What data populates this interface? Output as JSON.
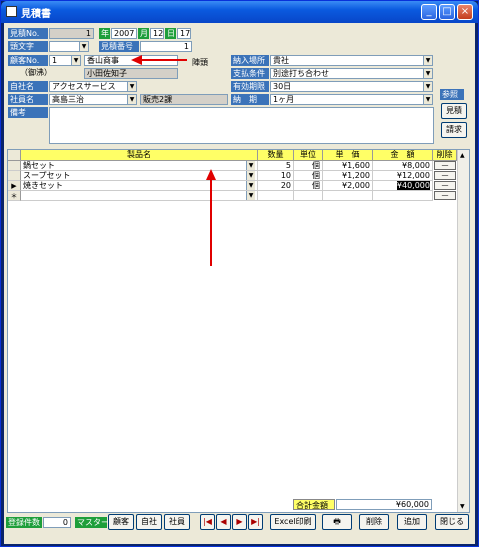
{
  "window": {
    "title": "見積書",
    "min": "_",
    "max": "□",
    "close": "×"
  },
  "header": {
    "estimate_no_label": "見積No.",
    "estimate_no": "1",
    "year_label": "年",
    "year": "2007",
    "month_label": "月",
    "month": "12",
    "day_label": "日",
    "day": "17",
    "head_char_label": "頭文字",
    "estimate_number_label": "見積番号",
    "estimate_number": "1",
    "customer_no_label": "顧客No.",
    "customer_no": "1",
    "customer_name": "香山商事",
    "honorific": "御中",
    "honorific_side": "陣頭",
    "contact": "小田佐知子",
    "contact_suffix": "（御沸）",
    "company_label": "自社名",
    "company": "アクセスサービス",
    "staff_label": "社員名",
    "staff": "高島三治",
    "dept": "販売2課",
    "notes_label": "備考"
  },
  "terms": {
    "delivery_place_label": "納入場所",
    "delivery_place": "貴社",
    "payment_label": "支払条件",
    "payment": "別途打ち合わせ",
    "valid_label": "有効期限",
    "valid": "30日",
    "delivery_label": "納　期",
    "delivery": "1ヶ月"
  },
  "ref": {
    "label": "参照",
    "estimate": "見積",
    "invoice": "請求"
  },
  "grid": {
    "headers": [
      "製品名",
      "数量",
      "単位",
      "単　価",
      "金　額",
      "削除"
    ],
    "rows": [
      {
        "name": "鍋セット",
        "qty": "5",
        "unit": "個",
        "price": "¥1,600",
        "amount": "¥8,000",
        "marker": ""
      },
      {
        "name": "スープセット",
        "qty": "10",
        "unit": "個",
        "price": "¥1,200",
        "amount": "¥12,000",
        "marker": ""
      },
      {
        "name": "焼きセット",
        "qty": "20",
        "unit": "個",
        "price": "¥2,000",
        "amount": "¥40,000",
        "marker": "▶"
      }
    ],
    "new_row_marker": "＊",
    "delete_label": "—"
  },
  "total": {
    "label": "合計金額",
    "value": "¥60,000"
  },
  "footer": {
    "count_label": "登録件数",
    "count": "0",
    "master_label": "マスター",
    "customer": "顧客",
    "company": "自社",
    "staff": "社員",
    "first": "|◀",
    "prev": "◀",
    "next": "▶",
    "last": "▶|",
    "excel": "Excel印刷",
    "print": "🖶",
    "delete": "削除",
    "add": "追加",
    "close": "閉じる"
  },
  "colors": {
    "label_blue": "#3b73b9",
    "label_green": "#1e9e3a",
    "header_yellow": "#ffff66",
    "arrow_red": "#e00000"
  }
}
